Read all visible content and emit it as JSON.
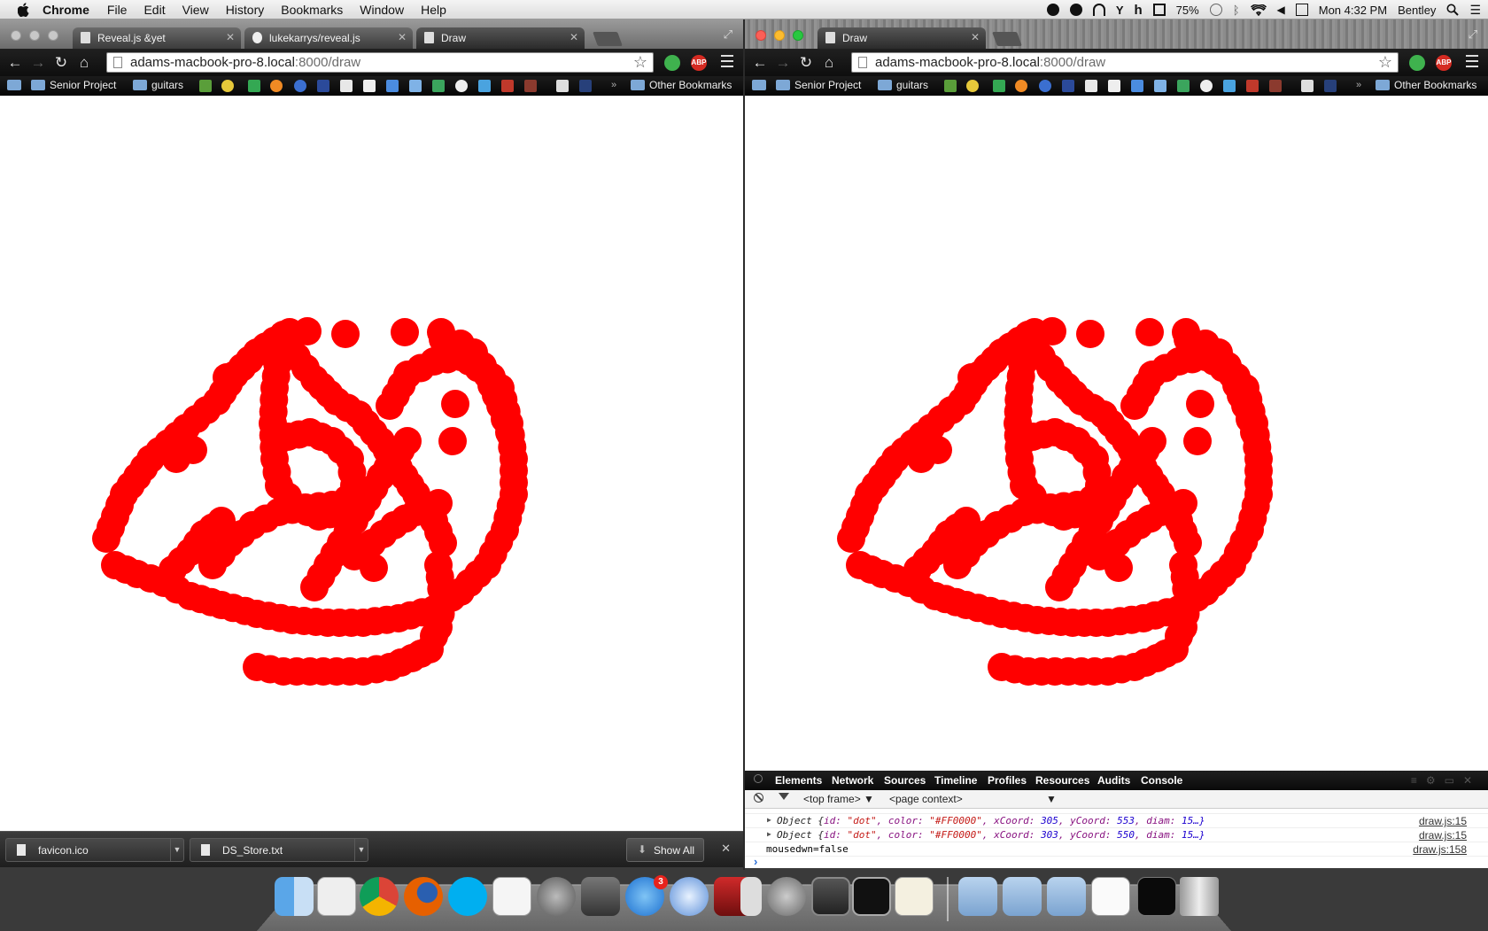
{
  "menubar": {
    "app_name": "Chrome",
    "menus": [
      "File",
      "Edit",
      "View",
      "History",
      "Bookmarks",
      "Window",
      "Help"
    ],
    "battery": "75%",
    "clock": "Mon 4:32 PM",
    "user": "Bentley",
    "status_icons": [
      "evernote-icon",
      "circle-e-icon",
      "headphones-icon",
      "fork-icon",
      "h-icon",
      "airplay-icon",
      "time-machine-icon",
      "bluetooth-icon",
      "wifi-icon",
      "volume-icon",
      "calendar-icon",
      "spotlight-icon",
      "notification-center-icon"
    ]
  },
  "left_window": {
    "tabs": [
      {
        "label": "Reveal.js &yet"
      },
      {
        "label": "lukekarrys/reveal.js"
      },
      {
        "label": "Draw"
      }
    ],
    "url_host": "adams-macbook-pro-8.local",
    "url_rest": ":8000/draw",
    "downloads": [
      {
        "name": "favicon.ico"
      },
      {
        "name": "DS_Store.txt"
      }
    ],
    "show_all": "Show All"
  },
  "right_window": {
    "tabs": [
      {
        "label": "Draw"
      }
    ],
    "url_host": "adams-macbook-pro-8.local",
    "url_rest": ":8000/draw"
  },
  "bookmarks": {
    "folder1": "Senior Project",
    "folder2": "guitars",
    "chevron": "»",
    "other": "Other Bookmarks"
  },
  "devtools": {
    "tabs": [
      "Elements",
      "Network",
      "Sources",
      "Timeline",
      "Profiles",
      "Resources",
      "Audits",
      "Console"
    ],
    "frame_select": "<top frame> ▼",
    "context_select": "<page context>",
    "context_caret": "▼",
    "log": [
      {
        "kind": "object",
        "xCoord": "305",
        "yCoord": "553",
        "src": "draw.js:15"
      },
      {
        "kind": "object",
        "xCoord": "303",
        "yCoord": "550",
        "src": "draw.js:15"
      },
      {
        "kind": "text",
        "text": "mousedwn=false",
        "src": "draw.js:158"
      }
    ],
    "obj_prefix": "Object {",
    "obj_id_key": "id: ",
    "obj_id_val": "\"dot\"",
    "obj_color_key": ", color: ",
    "obj_color_val": "\"#FF0000\"",
    "obj_x_key": ", xCoord: ",
    "obj_y_key": ", yCoord: ",
    "obj_diam_key": ", diam: ",
    "obj_diam_val": "15…}",
    "prompt": "›"
  },
  "drawing": {
    "dot_color": "#FF0000",
    "dot_diameter": 15
  },
  "dock": {
    "apps": [
      "finder-icon",
      "ampersand-app-icon",
      "chrome-icon",
      "firefox-icon",
      "skype-icon",
      "p-app-icon",
      "launchpad-icon",
      "photo-browser-icon",
      "app-store-icon",
      "itunes-icon",
      "photo-booth-icon",
      "photo-strip-icon",
      "system-preferences-icon",
      "sublime-text-icon",
      "terminal-icon",
      "textedit-icon",
      "applications-folder-icon",
      "documents-folder-icon",
      "downloads-folder-icon",
      "window-preview-icon",
      "screen-preview-icon",
      "trash-icon"
    ],
    "app_store_badge": "3"
  }
}
